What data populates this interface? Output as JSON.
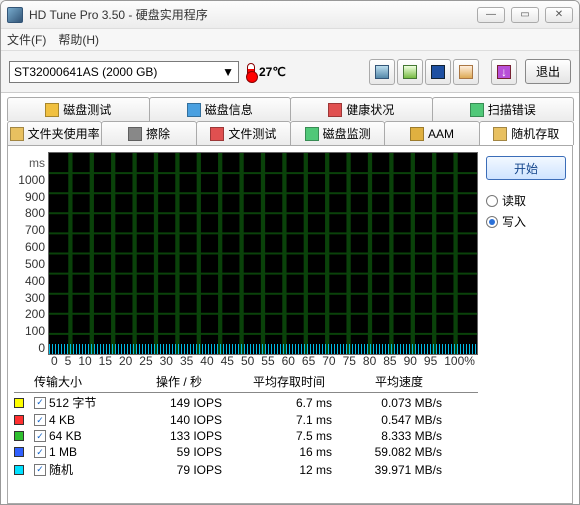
{
  "window": {
    "title": "HD Tune Pro 3.50 - 硬盘实用程序"
  },
  "menu": {
    "file": "文件(F)",
    "help": "帮助(H)"
  },
  "toolbar": {
    "drive": "ST32000641AS (2000 GB)",
    "temperature": "27℃",
    "exit": "退出"
  },
  "tabs_row1": [
    {
      "label": "磁盘测试",
      "icon": "benchmark"
    },
    {
      "label": "磁盘信息",
      "icon": "info"
    },
    {
      "label": "健康状况",
      "icon": "health"
    },
    {
      "label": "扫描错误",
      "icon": "scan"
    }
  ],
  "tabs_row2": [
    {
      "label": "文件夹使用率",
      "icon": "folder"
    },
    {
      "label": "擦除",
      "icon": "erase"
    },
    {
      "label": "文件测试",
      "icon": "filebench"
    },
    {
      "label": "磁盘监测",
      "icon": "monitor"
    },
    {
      "label": "AAM",
      "icon": "aam"
    },
    {
      "label": "随机存取",
      "icon": "random",
      "active": true
    }
  ],
  "side": {
    "start": "开始",
    "read": "读取",
    "write": "写入",
    "selected": "write"
  },
  "chart_data": {
    "type": "scatter",
    "title": "",
    "ylabel": "ms",
    "ylim": [
      0,
      1000
    ],
    "yticks": [
      0,
      100,
      200,
      300,
      400,
      500,
      600,
      700,
      800,
      900,
      1000
    ],
    "xlabel": "%",
    "xlim": [
      0,
      100
    ],
    "xticks": [
      0,
      5,
      10,
      15,
      20,
      25,
      30,
      35,
      40,
      45,
      50,
      55,
      60,
      65,
      70,
      75,
      80,
      85,
      90,
      95,
      100
    ],
    "series": [
      {
        "name": "512 字节",
        "color": "#ffff00",
        "values": "dense-baseline"
      },
      {
        "name": "4 KB",
        "color": "#ff3030",
        "values": "dense-baseline"
      },
      {
        "name": "64 KB",
        "color": "#30c030",
        "values": "dense-baseline"
      },
      {
        "name": "1 MB",
        "color": "#3060ff",
        "values": "dense-baseline"
      },
      {
        "name": "随机",
        "color": "#00e0ff",
        "values": "dense-baseline"
      }
    ],
    "note": "All series render as dense points near y≈0–20ms across x=0–100%"
  },
  "table": {
    "headers": {
      "size": "传输大小",
      "ops": "操作 / 秒",
      "access": "平均存取时间",
      "speed": "平均速度"
    },
    "rows": [
      {
        "color": "#ffff00",
        "checked": true,
        "size": "512 字节",
        "ops": "149 IOPS",
        "access": "6.7 ms",
        "speed": "0.073 MB/s"
      },
      {
        "color": "#ff3030",
        "checked": true,
        "size": "4 KB",
        "ops": "140 IOPS",
        "access": "7.1 ms",
        "speed": "0.547 MB/s"
      },
      {
        "color": "#30c030",
        "checked": true,
        "size": "64 KB",
        "ops": "133 IOPS",
        "access": "7.5 ms",
        "speed": "8.333 MB/s"
      },
      {
        "color": "#3060ff",
        "checked": true,
        "size": "1 MB",
        "ops": "59 IOPS",
        "access": "16 ms",
        "speed": "59.082 MB/s"
      },
      {
        "color": "#00e0ff",
        "checked": true,
        "size": "随机",
        "ops": "79 IOPS",
        "access": "12 ms",
        "speed": "39.971 MB/s"
      }
    ]
  }
}
